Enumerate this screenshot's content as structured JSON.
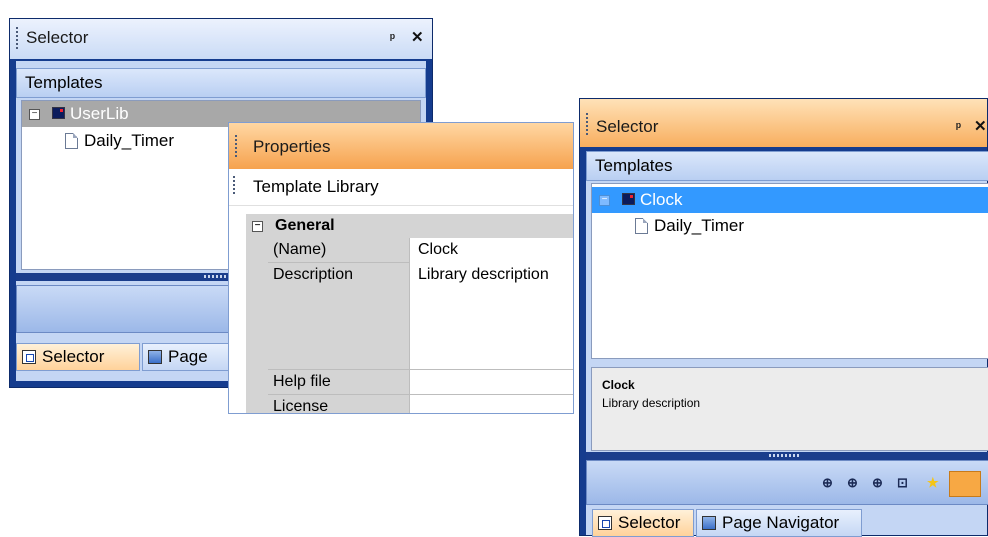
{
  "left_selector": {
    "title": "Selector",
    "section": "Templates",
    "tree": [
      {
        "label": "UserLib",
        "type": "library"
      },
      {
        "label": "Daily_Timer",
        "type": "template"
      }
    ],
    "tabs": [
      {
        "label": "Selector",
        "icon": "selector-icon"
      },
      {
        "label": "Page",
        "icon": "page-navigator-icon"
      }
    ]
  },
  "properties": {
    "title": "Properties",
    "object_type": "Template Library",
    "category": "General",
    "rows": [
      {
        "name": "(Name)",
        "value": "Clock"
      },
      {
        "name": "Description",
        "value": "Library description"
      },
      {
        "name": "Help file",
        "value": ""
      },
      {
        "name": "License",
        "value": ""
      }
    ]
  },
  "right_selector": {
    "title": "Selector",
    "section": "Templates",
    "tree": [
      {
        "label": "Clock",
        "type": "library",
        "selected": true
      },
      {
        "label": "Daily_Timer",
        "type": "template"
      }
    ],
    "description_title": "Clock",
    "description_text": "Library description",
    "toolbar_icons": [
      "insert-s-icon",
      "insert-r-icon",
      "insert-d-icon",
      "insert-bracket-icon",
      "star-icon",
      "panel-icon"
    ],
    "tabs": [
      {
        "label": "Selector",
        "icon": "selector-icon"
      },
      {
        "label": "Page Navigator",
        "icon": "page-navigator-icon"
      }
    ]
  },
  "colors": {
    "selection": "#3399ff",
    "inactive_selection": "#a8a8a8",
    "title_active": "#f6a24e",
    "frame_blue": "#153c8e"
  }
}
